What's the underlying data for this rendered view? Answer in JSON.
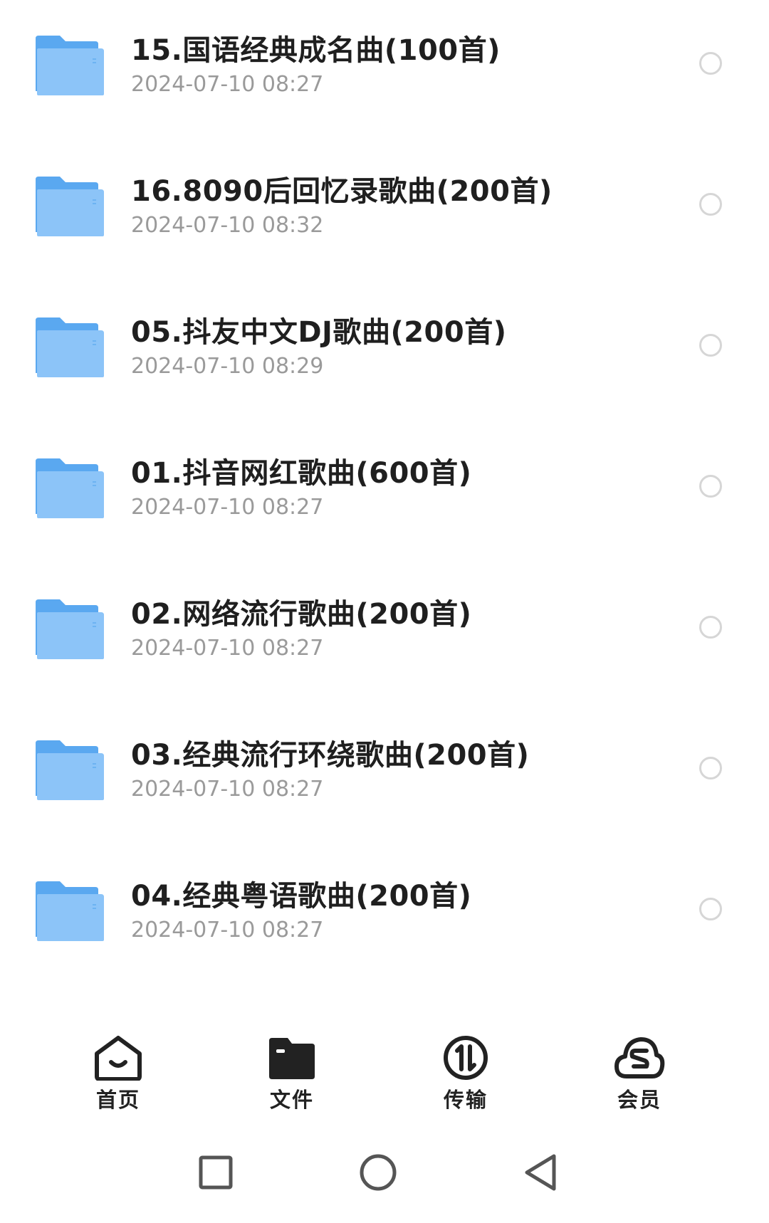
{
  "folders": [
    {
      "name": "15.国语经典成名曲(100首)",
      "date": "2024-07-10 08:27"
    },
    {
      "name": "16.8090后回忆录歌曲(200首)",
      "date": "2024-07-10 08:32"
    },
    {
      "name": "05.抖友中文DJ歌曲(200首)",
      "date": "2024-07-10 08:29"
    },
    {
      "name": "01.抖音网红歌曲(600首)",
      "date": "2024-07-10 08:27"
    },
    {
      "name": "02.网络流行歌曲(200首)",
      "date": "2024-07-10 08:27"
    },
    {
      "name": "03.经典流行环绕歌曲(200首)",
      "date": "2024-07-10 08:27"
    },
    {
      "name": "04.经典粤语歌曲(200首)",
      "date": "2024-07-10 08:27"
    }
  ],
  "folder_icon": "folder-icon",
  "colors": {
    "folder_back": "#5aa8f0",
    "folder_front": "#8cc4f8",
    "tab_icon": "#222222",
    "date_text": "#9a9a9a",
    "radio_border": "#d6d6d6"
  },
  "tabbar": {
    "home": {
      "label": "首页",
      "icon": "home-icon"
    },
    "files": {
      "label": "文件",
      "icon": "folder-filled-icon"
    },
    "transfer": {
      "label": "传输",
      "icon": "transfer-icon"
    },
    "vip": {
      "label": "会员",
      "icon": "cloud-s-icon"
    }
  },
  "system_nav": {
    "recents": "square-icon",
    "home": "circle-icon",
    "back": "triangle-back-icon"
  }
}
